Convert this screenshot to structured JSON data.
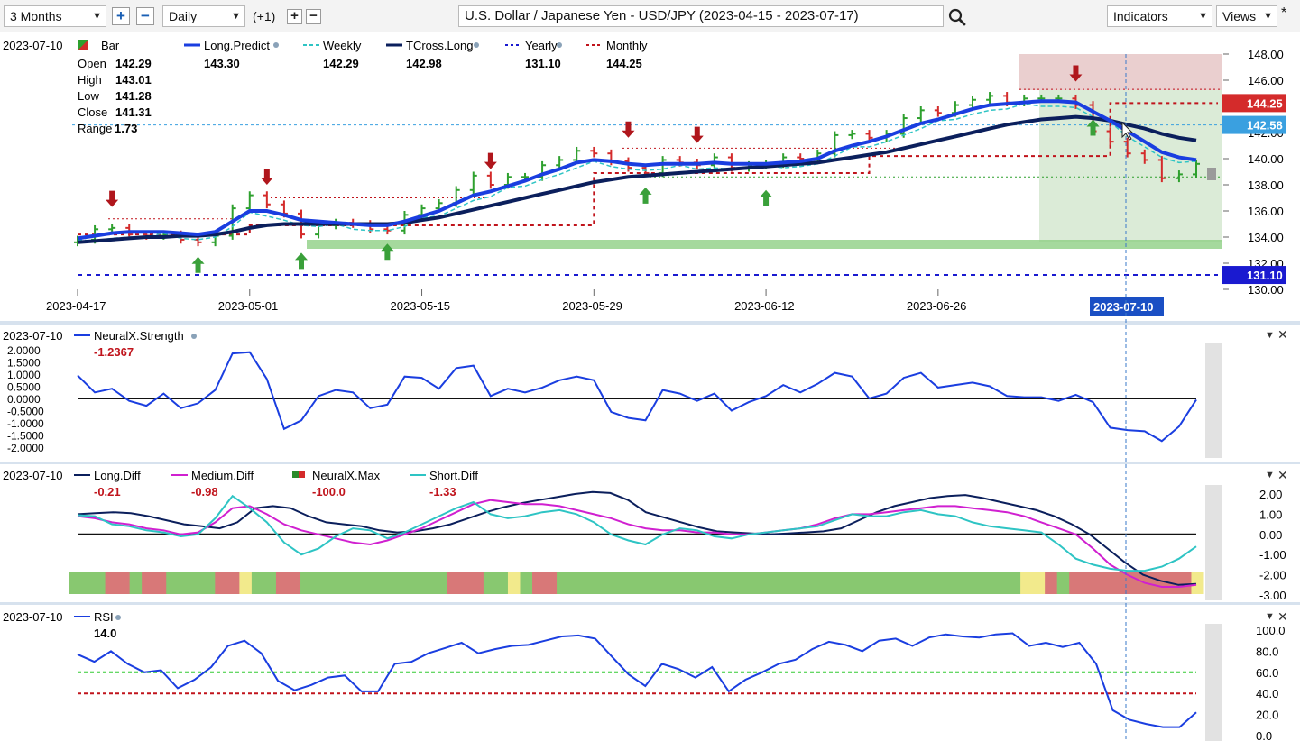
{
  "toolbar": {
    "period": "3 Months",
    "interval": "Daily",
    "offset": "(+1)",
    "symbol_title": "U.S. Dollar / Japanese Yen - USD/JPY (2023-04-15 - 2023-07-17)",
    "indicators_label": "Indicators",
    "views_label": "Views",
    "star": "*"
  },
  "main_legend": {
    "date": "2023-07-10",
    "bar_label": "Bar",
    "ohlc": [
      {
        "label": "Open",
        "value": "142.29"
      },
      {
        "label": "High",
        "value": "143.01"
      },
      {
        "label": "Low",
        "value": "141.28"
      },
      {
        "label": "Close",
        "value": "141.31"
      },
      {
        "label": "Range",
        "value": "1.73"
      }
    ],
    "series": [
      {
        "name": "Long.Predict",
        "value": "143.30",
        "color": "#1a3ee0"
      },
      {
        "name": "Weekly",
        "value": "142.29",
        "color": "#2ec4c4"
      },
      {
        "name": "TCross.Long",
        "value": "142.98",
        "color": "#0b1f5c"
      },
      {
        "name": "Yearly",
        "value": "131.10",
        "color": "#1a1ad0"
      },
      {
        "name": "Monthly",
        "value": "144.25",
        "color": "#c0141c"
      }
    ]
  },
  "main_axis": {
    "y_ticks": [
      "148.00",
      "146.00",
      "144.00",
      "142.00",
      "140.00",
      "138.00",
      "136.00",
      "134.00",
      "132.00",
      "130.00"
    ],
    "x_ticks": [
      "2023-04-17",
      "2023-05-01",
      "2023-05-15",
      "2023-05-29",
      "2023-06-12",
      "2023-06-26"
    ],
    "x_highlight": "2023-07-10",
    "price_tags": [
      {
        "value": "144.25",
        "color": "#d42b2b"
      },
      {
        "value": "142.58",
        "color": "#3aa0e0"
      },
      {
        "value": "131.10",
        "color": "#1a1ad0"
      }
    ]
  },
  "neural_pane": {
    "date": "2023-07-10",
    "title": "NeuralX.Strength",
    "value": "-1.2367",
    "y_ticks": [
      "2.0000",
      "1.5000",
      "1.0000",
      "0.5000",
      "0.0000",
      "-0.5000",
      "-1.0000",
      "-1.5000",
      "-2.0000"
    ]
  },
  "diff_pane": {
    "date": "2023-07-10",
    "items": [
      {
        "name": "Long.Diff",
        "value": "-0.21",
        "color": "#0b1f5c"
      },
      {
        "name": "Medium.Diff",
        "value": "-0.98",
        "color": "#d020d0"
      },
      {
        "name": "NeuralX.Max",
        "value": "-100.0",
        "color": "#2a8a2a"
      },
      {
        "name": "Short.Diff",
        "value": "-1.33",
        "color": "#2ec4c4"
      }
    ],
    "y_ticks": [
      "2.00",
      "1.00",
      "0.00",
      "-1.00",
      "-2.00",
      "-3.00"
    ],
    "signal_band": [
      "green",
      "green",
      "green",
      "red",
      "red",
      "green",
      "red",
      "red",
      "green",
      "green",
      "green",
      "green",
      "red",
      "red",
      "yellow",
      "green",
      "green",
      "red",
      "red",
      "green",
      "green",
      "green",
      "green",
      "green",
      "green",
      "green",
      "green",
      "green",
      "green",
      "green",
      "green",
      "red",
      "red",
      "red",
      "green",
      "green",
      "yellow",
      "green",
      "red",
      "red",
      "green",
      "green",
      "green",
      "green",
      "green",
      "green",
      "green",
      "green",
      "green",
      "green",
      "green",
      "green",
      "green",
      "green",
      "green",
      "green",
      "green",
      "green",
      "green",
      "green",
      "green",
      "green",
      "green",
      "green",
      "green",
      "green",
      "green",
      "green",
      "green",
      "green",
      "green",
      "green",
      "green",
      "green",
      "green",
      "green",
      "green",
      "green",
      "yellow",
      "yellow",
      "red",
      "green",
      "red",
      "red",
      "red",
      "red",
      "red",
      "red",
      "red",
      "red",
      "red",
      "red",
      "yellow"
    ]
  },
  "rsi_pane": {
    "date": "2023-07-10",
    "title": "RSI",
    "value": "14.0",
    "y_ticks": [
      "100.0",
      "80.0",
      "60.0",
      "40.0",
      "20.0",
      "0.0"
    ]
  },
  "chart_data": [
    {
      "type": "candlestick",
      "title": "U.S. Dollar / Japanese Yen - USD/JPY (2023-04-15 - 2023-07-17)",
      "ylim": [
        130,
        148
      ],
      "x": [
        "2023-04-17",
        "2023-04-18",
        "2023-04-19",
        "2023-04-20",
        "2023-04-21",
        "2023-04-24",
        "2023-04-25",
        "2023-04-26",
        "2023-04-27",
        "2023-04-28",
        "2023-05-01",
        "2023-05-02",
        "2023-05-03",
        "2023-05-04",
        "2023-05-05",
        "2023-05-08",
        "2023-05-09",
        "2023-05-10",
        "2023-05-11",
        "2023-05-12",
        "2023-05-15",
        "2023-05-16",
        "2023-05-17",
        "2023-05-18",
        "2023-05-19",
        "2023-05-22",
        "2023-05-23",
        "2023-05-24",
        "2023-05-25",
        "2023-05-26",
        "2023-05-29",
        "2023-05-30",
        "2023-05-31",
        "2023-06-01",
        "2023-06-02",
        "2023-06-05",
        "2023-06-06",
        "2023-06-07",
        "2023-06-08",
        "2023-06-09",
        "2023-06-12",
        "2023-06-13",
        "2023-06-14",
        "2023-06-15",
        "2023-06-16",
        "2023-06-19",
        "2023-06-20",
        "2023-06-21",
        "2023-06-22",
        "2023-06-23",
        "2023-06-26",
        "2023-06-27",
        "2023-06-28",
        "2023-06-29",
        "2023-06-30",
        "2023-07-03",
        "2023-07-04",
        "2023-07-05",
        "2023-07-06",
        "2023-07-07",
        "2023-07-10",
        "2023-07-11",
        "2023-07-12",
        "2023-07-13",
        "2023-07-14",
        "2023-07-17"
      ],
      "close": [
        133.8,
        134.6,
        134.7,
        134.2,
        134.1,
        134.2,
        133.8,
        133.6,
        134.1,
        136.2,
        137.2,
        136.5,
        135.8,
        134.2,
        134.9,
        135.1,
        135.0,
        134.6,
        134.5,
        135.7,
        136.2,
        136.6,
        137.6,
        138.7,
        138.0,
        138.6,
        138.6,
        139.5,
        139.9,
        140.6,
        140.4,
        139.8,
        139.3,
        138.9,
        139.9,
        139.7,
        139.5,
        140.1,
        139.3,
        139.5,
        139.6,
        140.1,
        140.0,
        140.4,
        141.8,
        141.9,
        141.6,
        141.9,
        143.1,
        143.7,
        143.5,
        144.1,
        144.5,
        144.8,
        144.3,
        144.6,
        144.6,
        144.6,
        144.1,
        142.1,
        141.3,
        140.4,
        139.9,
        138.5,
        138.8,
        139.6
      ],
      "series": [
        {
          "name": "Long.Predict",
          "values": [
            133.9,
            134.1,
            134.3,
            134.4,
            134.4,
            134.4,
            134.3,
            134.2,
            134.4,
            135.2,
            136.0,
            136.0,
            135.7,
            135.3,
            135.2,
            135.1,
            135.0,
            134.9,
            134.9,
            135.2,
            135.6,
            136.0,
            136.6,
            137.2,
            137.5,
            137.9,
            138.3,
            138.8,
            139.2,
            139.7,
            139.9,
            139.8,
            139.6,
            139.5,
            139.6,
            139.6,
            139.6,
            139.7,
            139.6,
            139.6,
            139.6,
            139.7,
            139.8,
            140.0,
            140.6,
            141.0,
            141.3,
            141.7,
            142.2,
            142.7,
            143.0,
            143.4,
            143.8,
            144.1,
            144.2,
            144.3,
            144.4,
            144.4,
            144.3,
            143.6,
            142.9,
            142.1,
            141.3,
            140.5,
            140.1,
            139.9
          ]
        },
        {
          "name": "TCross.Long",
          "values": [
            133.6,
            133.7,
            133.8,
            133.9,
            134.0,
            134.0,
            134.1,
            134.1,
            134.2,
            134.4,
            134.7,
            134.9,
            135.0,
            135.0,
            135.0,
            135.0,
            135.0,
            135.0,
            135.0,
            135.1,
            135.3,
            135.5,
            135.8,
            136.1,
            136.4,
            136.7,
            137.0,
            137.3,
            137.6,
            137.9,
            138.2,
            138.4,
            138.6,
            138.7,
            138.8,
            138.9,
            139.0,
            139.1,
            139.2,
            139.3,
            139.4,
            139.5,
            139.6,
            139.7,
            139.9,
            140.1,
            140.3,
            140.5,
            140.8,
            141.1,
            141.4,
            141.7,
            142.0,
            142.3,
            142.6,
            142.8,
            143.0,
            143.1,
            143.2,
            143.1,
            142.9,
            142.6,
            142.3,
            141.9,
            141.6,
            141.4
          ]
        }
      ],
      "levels": {
        "Yearly": 131.1,
        "Monthly": 144.25,
        "Weekly": 142.29
      }
    },
    {
      "type": "line",
      "title": "NeuralX.Strength",
      "ylim": [
        -2,
        2
      ],
      "series": [
        {
          "name": "NeuralX.Strength",
          "values": [
            0.95,
            0.25,
            0.4,
            -0.1,
            -0.3,
            0.2,
            -0.4,
            -0.2,
            0.35,
            1.85,
            1.9,
            0.8,
            -1.25,
            -0.9,
            0.1,
            0.35,
            0.25,
            -0.4,
            -0.25,
            0.9,
            0.85,
            0.4,
            1.25,
            1.35,
            0.1,
            0.4,
            0.25,
            0.45,
            0.75,
            0.9,
            0.75,
            -0.55,
            -0.8,
            -0.9,
            0.35,
            0.2,
            -0.1,
            0.2,
            -0.5,
            -0.15,
            0.1,
            0.55,
            0.25,
            0.6,
            1.05,
            0.9,
            0.0,
            0.2,
            0.85,
            1.05,
            0.45,
            0.55,
            0.65,
            0.5,
            0.1,
            0.05,
            0.05,
            -0.1,
            0.15,
            -0.15,
            -1.2,
            -1.3,
            -1.35,
            -1.75,
            -1.15,
            -0.05
          ]
        }
      ]
    },
    {
      "type": "line",
      "title": "Diff",
      "ylim": [
        -3,
        2.5
      ],
      "series": [
        {
          "name": "Long.Diff",
          "values": [
            1.0,
            1.05,
            1.1,
            1.05,
            0.9,
            0.7,
            0.5,
            0.4,
            0.3,
            0.6,
            1.3,
            1.4,
            1.3,
            0.9,
            0.6,
            0.5,
            0.4,
            0.2,
            0.1,
            0.15,
            0.3,
            0.5,
            0.8,
            1.1,
            1.35,
            1.55,
            1.7,
            1.85,
            2.0,
            2.1,
            2.05,
            1.7,
            1.1,
            0.85,
            0.6,
            0.35,
            0.15,
            0.1,
            0.05,
            0.0,
            0.05,
            0.1,
            0.15,
            0.3,
            0.7,
            1.1,
            1.4,
            1.6,
            1.8,
            1.9,
            1.95,
            1.8,
            1.6,
            1.4,
            1.2,
            0.9,
            0.5,
            0.0,
            -0.7,
            -1.4,
            -2.0,
            -2.3,
            -2.5,
            -2.45
          ]
        },
        {
          "name": "Medium.Diff",
          "values": [
            0.9,
            0.8,
            0.6,
            0.5,
            0.3,
            0.2,
            0.0,
            0.1,
            0.6,
            1.3,
            1.4,
            1.0,
            0.5,
            0.2,
            0.0,
            -0.2,
            -0.4,
            -0.5,
            -0.3,
            0.0,
            0.3,
            0.7,
            1.1,
            1.5,
            1.7,
            1.6,
            1.5,
            1.5,
            1.4,
            1.2,
            1.0,
            0.8,
            0.5,
            0.3,
            0.2,
            0.2,
            0.1,
            0.1,
            0.0,
            0.0,
            0.1,
            0.2,
            0.3,
            0.5,
            0.8,
            1.0,
            1.0,
            1.1,
            1.2,
            1.3,
            1.4,
            1.4,
            1.3,
            1.2,
            1.1,
            0.9,
            0.6,
            0.3,
            0.0,
            -0.7,
            -1.5,
            -2.0,
            -2.4,
            -2.6,
            -2.6,
            -2.5
          ]
        },
        {
          "name": "Short.Diff",
          "values": [
            0.95,
            0.9,
            0.5,
            0.4,
            0.2,
            0.1,
            -0.1,
            0.0,
            0.8,
            1.9,
            1.3,
            0.6,
            -0.4,
            -1.0,
            -0.7,
            -0.1,
            0.3,
            0.2,
            -0.2,
            0.1,
            0.5,
            0.9,
            1.3,
            1.6,
            1.0,
            0.8,
            0.9,
            1.1,
            1.2,
            1.0,
            0.6,
            0.0,
            -0.3,
            -0.5,
            0.0,
            0.3,
            0.2,
            -0.1,
            -0.2,
            0.0,
            0.1,
            0.2,
            0.3,
            0.4,
            0.7,
            1.0,
            0.9,
            0.9,
            1.1,
            1.2,
            1.0,
            0.9,
            0.6,
            0.4,
            0.3,
            0.2,
            0.1,
            -0.5,
            -1.2,
            -1.5,
            -1.7,
            -1.8,
            -1.8,
            -1.6,
            -1.2,
            -0.6
          ]
        }
      ]
    },
    {
      "type": "line",
      "title": "RSI",
      "ylim": [
        0,
        100
      ],
      "series": [
        {
          "name": "RSI",
          "values": [
            77,
            70,
            80,
            68,
            60,
            62,
            45,
            53,
            65,
            85,
            90,
            78,
            52,
            43,
            48,
            55,
            57,
            42,
            42,
            68,
            70,
            78,
            83,
            88,
            78,
            82,
            85,
            86,
            90,
            94,
            95,
            92,
            75,
            58,
            47,
            68,
            63,
            55,
            65,
            42,
            53,
            60,
            68,
            72,
            82,
            89,
            86,
            80,
            90,
            92,
            85,
            93,
            96,
            94,
            93,
            96,
            97,
            85,
            88,
            84,
            88,
            68,
            24,
            15,
            11,
            8,
            8,
            22
          ]
        }
      ],
      "levels": {
        "upper": 60,
        "lower": 40
      }
    }
  ]
}
